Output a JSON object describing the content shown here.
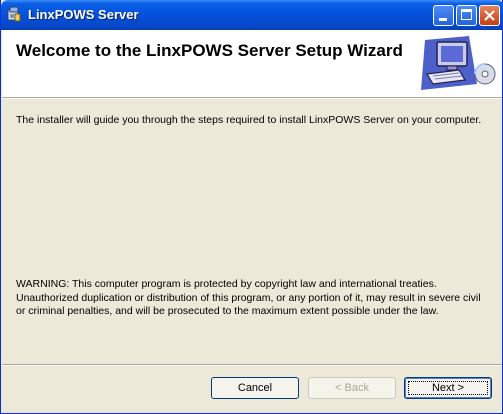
{
  "window": {
    "title": "LinxPOWS Server"
  },
  "header": {
    "title": "Welcome to the LinxPOWS Server Setup Wizard",
    "graphic": "computer-setup-icon"
  },
  "body": {
    "intro": "The installer will guide you through the steps required to install LinxPOWS Server on your computer.",
    "warning": "WARNING: This computer program is protected by copyright law and international treaties.\nUnauthorized duplication or distribution of this program, or any portion of it, may result in severe civil\nor criminal penalties, and will be prosecuted to the maximum extent possible under the law."
  },
  "buttons": {
    "cancel": "Cancel",
    "back": "< Back",
    "next": "Next >"
  },
  "colors": {
    "titlebar": "#0551dc",
    "dialog_face": "#ece9d8",
    "header_background": "#ffffff"
  }
}
